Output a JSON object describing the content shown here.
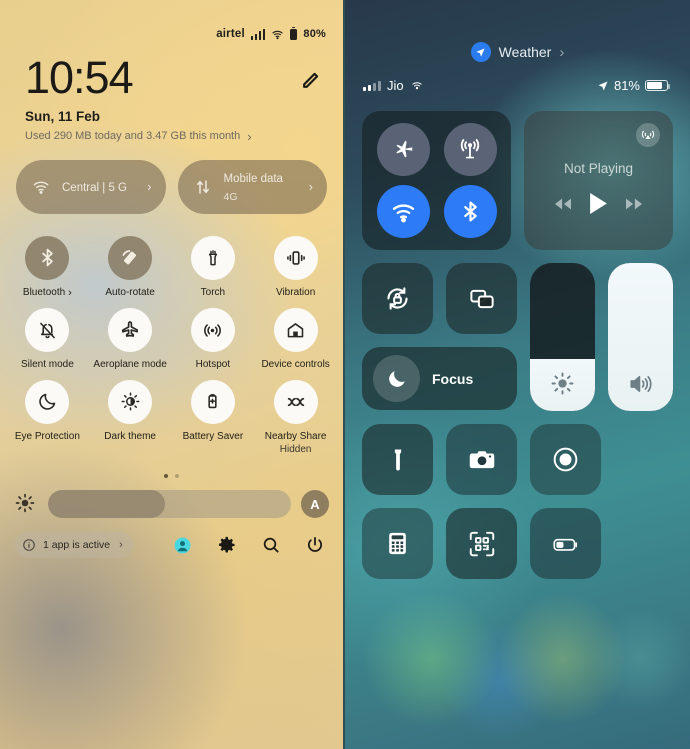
{
  "android": {
    "status": {
      "carrier": "airtel",
      "battery_percent": "80%"
    },
    "clock": "10:54",
    "date": "Sun, 11 Feb",
    "data_usage": "Used 290 MB today and 3.47 GB this month",
    "chevron": "›",
    "edit_icon": "pencil-icon",
    "connections": [
      {
        "icon": "wifi-icon",
        "title": "Central | 5 G",
        "subtitle": ""
      },
      {
        "icon": "mobile-data-icon",
        "title": "Mobile data",
        "subtitle": "4G"
      }
    ],
    "tiles": [
      {
        "label": "Bluetooth",
        "state": "off",
        "has_chevron": true,
        "icon": "bluetooth-icon",
        "sub": ""
      },
      {
        "label": "Auto-rotate",
        "state": "off",
        "has_chevron": false,
        "icon": "auto-rotate-icon",
        "sub": ""
      },
      {
        "label": "Torch",
        "state": "on",
        "has_chevron": false,
        "icon": "torch-icon",
        "sub": ""
      },
      {
        "label": "Vibration",
        "state": "on",
        "has_chevron": false,
        "icon": "vibration-icon",
        "sub": ""
      },
      {
        "label": "Silent mode",
        "state": "on",
        "has_chevron": false,
        "icon": "bell-off-icon",
        "sub": ""
      },
      {
        "label": "Aeroplane mode",
        "state": "on",
        "has_chevron": false,
        "icon": "airplane-icon",
        "sub": ""
      },
      {
        "label": "Hotspot",
        "state": "on",
        "has_chevron": false,
        "icon": "hotspot-icon",
        "sub": ""
      },
      {
        "label": "Device controls",
        "state": "on",
        "has_chevron": false,
        "icon": "home-icon",
        "sub": ""
      },
      {
        "label": "Eye Protection",
        "state": "on",
        "has_chevron": false,
        "icon": "moon-icon",
        "sub": ""
      },
      {
        "label": "Dark theme",
        "state": "on",
        "has_chevron": false,
        "icon": "dark-theme-icon",
        "sub": ""
      },
      {
        "label": "Battery Saver",
        "state": "on",
        "has_chevron": false,
        "icon": "battery-saver-icon",
        "sub": ""
      },
      {
        "label": "Nearby Share",
        "state": "on",
        "has_chevron": false,
        "icon": "nearby-share-icon",
        "sub": "Hidden"
      }
    ],
    "page_dots": {
      "count": 2,
      "active": 0
    },
    "brightness": {
      "icon": "brightness-icon",
      "percent": 48,
      "auto_label": "A"
    },
    "footer": {
      "active_apps": "1 app is active",
      "info_icon": "info-icon",
      "chevron": "›",
      "icons": [
        {
          "name": "user-avatar-icon"
        },
        {
          "name": "settings-gear-icon"
        },
        {
          "name": "search-icon"
        },
        {
          "name": "power-icon"
        }
      ]
    }
  },
  "ios": {
    "header": {
      "app": "Weather",
      "icon": "location-arrow-icon",
      "chevron": "›"
    },
    "status": {
      "carrier": "Jio",
      "wifi_icon": "wifi-icon",
      "location_icon": "location-arrow-icon",
      "battery_percent": "81%",
      "battery_fill": 81
    },
    "connectivity": [
      {
        "name": "airplane-mode-button",
        "icon": "airplane-icon",
        "state": "off"
      },
      {
        "name": "cellular-data-button",
        "icon": "cellular-icon",
        "state": "off"
      },
      {
        "name": "wifi-button",
        "icon": "wifi-icon",
        "state": "on"
      },
      {
        "name": "bluetooth-button",
        "icon": "bluetooth-icon",
        "state": "on"
      }
    ],
    "media": {
      "title": "Not Playing",
      "airplay_icon": "airplay-icon",
      "prev": "rewind-icon",
      "play": "play-icon",
      "next": "fast-forward-icon"
    },
    "rotation_lock": {
      "icon": "rotation-lock-icon"
    },
    "screen_mirroring": {
      "icon": "screen-mirroring-icon"
    },
    "focus": {
      "label": "Focus",
      "icon": "moon-icon"
    },
    "brightness": {
      "icon": "brightness-icon",
      "percent": 35
    },
    "volume": {
      "icon": "volume-icon",
      "percent": 100
    },
    "buttons": [
      {
        "name": "flashlight-button",
        "icon": "flashlight-icon",
        "tone": "t1"
      },
      {
        "name": "camera-button",
        "icon": "camera-icon",
        "tone": "t2"
      },
      {
        "name": "screen-record-button",
        "icon": "screen-record-icon",
        "tone": "t3"
      },
      {
        "name": "calculator-button",
        "icon": "calculator-icon",
        "tone": "t3"
      },
      {
        "name": "qr-scanner-button",
        "icon": "qr-code-icon",
        "tone": "t1"
      },
      {
        "name": "low-power-mode-button",
        "icon": "low-battery-icon",
        "tone": "t2"
      }
    ]
  }
}
